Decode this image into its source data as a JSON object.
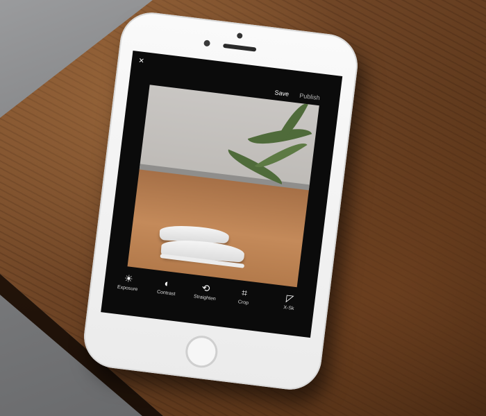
{
  "app": {
    "topbar": {
      "close_glyph": "×",
      "save_label": "Save",
      "publish_label": "Publish"
    },
    "tools": [
      {
        "label": "Exposure",
        "icon": "sun-icon",
        "glyph": "☀"
      },
      {
        "label": "Contrast",
        "icon": "contrast-icon",
        "glyph": "◐"
      },
      {
        "label": "Straighten",
        "icon": "straighten-icon",
        "glyph": "⟲"
      },
      {
        "label": "Crop",
        "icon": "crop-icon",
        "glyph": "⌗"
      },
      {
        "label": "X-Sk",
        "icon": "skew-icon",
        "glyph": "◸"
      }
    ],
    "bottom_nav": [
      {
        "icon": "presets-wheel-icon",
        "glyph": "✲"
      },
      {
        "icon": "tools-sliders-icon",
        "glyph": "⚌"
      },
      {
        "icon": "undo-icon",
        "glyph": "↶"
      },
      {
        "icon": "menu-list-icon",
        "glyph": "☰"
      }
    ]
  },
  "colors": {
    "screen_background": "#0b0b0b",
    "text_primary": "#ffffff",
    "text_muted": "#b9b9b9"
  }
}
